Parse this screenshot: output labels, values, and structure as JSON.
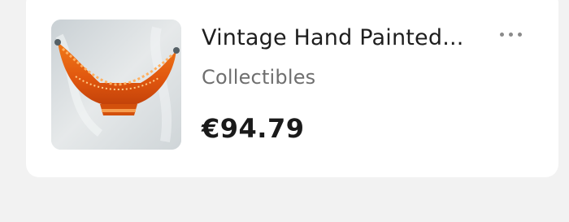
{
  "listing": {
    "title": "Vintage Hand Painted...",
    "category": "Collectibles",
    "price": "€94.79",
    "image_icon": "product-photo",
    "menu_icon": "more-dots-icon"
  },
  "colors": {
    "background": "#f2f2f2",
    "card": "#ffffff",
    "title_text": "#1e1e1e",
    "category_text": "#6f6f6f",
    "price_text": "#1a1a1a",
    "dots": "#8a8a8a"
  }
}
